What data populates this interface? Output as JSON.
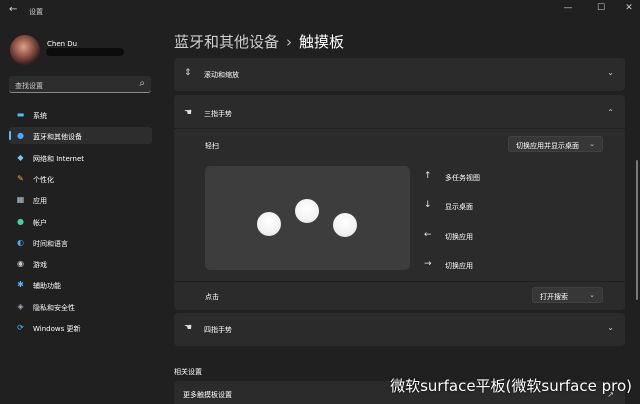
{
  "window": {
    "back_icon": "←",
    "title": "设置",
    "minimize": "—",
    "maximize": "☐",
    "close": "✕"
  },
  "user": {
    "name": "Chen Du"
  },
  "search": {
    "placeholder": "查找设置",
    "icon": "⌕"
  },
  "nav": [
    {
      "label": "系统",
      "icon": "system-icon",
      "glyph": "▬",
      "color": "#4cc2ff"
    },
    {
      "label": "蓝牙和其他设备",
      "icon": "bluetooth-icon",
      "glyph": "●",
      "color": "#4aa8ff"
    },
    {
      "label": "网络和 Internet",
      "icon": "network-icon",
      "glyph": "◆",
      "color": "#7bc8f5"
    },
    {
      "label": "个性化",
      "icon": "personalization-icon",
      "glyph": "✎",
      "color": "#f2a35b"
    },
    {
      "label": "应用",
      "icon": "apps-icon",
      "glyph": "▦",
      "color": "#b8c5d6"
    },
    {
      "label": "帐户",
      "icon": "accounts-icon",
      "glyph": "●",
      "color": "#3ed3a2"
    },
    {
      "label": "时间和语言",
      "icon": "time-language-icon",
      "glyph": "◐",
      "color": "#53a5e6"
    },
    {
      "label": "游戏",
      "icon": "gaming-icon",
      "glyph": "◉",
      "color": "#c9c9c9"
    },
    {
      "label": "辅助功能",
      "icon": "accessibility-icon",
      "glyph": "✱",
      "color": "#5fb3ff"
    },
    {
      "label": "隐私和安全性",
      "icon": "privacy-icon",
      "glyph": "◈",
      "color": "#a0a8b5"
    },
    {
      "label": "Windows 更新",
      "icon": "windows-update-icon",
      "glyph": "⟳",
      "color": "#4cc2ff"
    }
  ],
  "breadcrumb": {
    "parent": "蓝牙和其他设备",
    "separator": "›",
    "current": "触摸板"
  },
  "cards": {
    "scroll_zoom": {
      "title": "滚动和缩放",
      "icon": "scroll-icon",
      "glyph": "⇕",
      "chevron": "⌄"
    },
    "three_finger": {
      "title": "三指手势",
      "icon": "hand-icon",
      "glyph": "☚",
      "chevron": "⌃",
      "swipe_label": "轻扫",
      "swipe_value": "切换应用并显示桌面",
      "gestures": [
        {
          "arrow": "↑",
          "label": "多任务视图"
        },
        {
          "arrow": "↓",
          "label": "显示桌面"
        },
        {
          "arrow": "←",
          "label": "切换应用"
        },
        {
          "arrow": "→",
          "label": "切换应用"
        }
      ],
      "tap_label": "点击",
      "tap_value": "打开搜索"
    },
    "four_finger": {
      "title": "四指手势",
      "icon": "hand-icon",
      "glyph": "☚",
      "chevron": "⌄"
    }
  },
  "related": {
    "title": "相关设置",
    "item": "更多触摸板设置",
    "item_icon": "external-link-icon",
    "item_glyph": "↗"
  },
  "watermark": "微软surface平板(微软surface pro)"
}
